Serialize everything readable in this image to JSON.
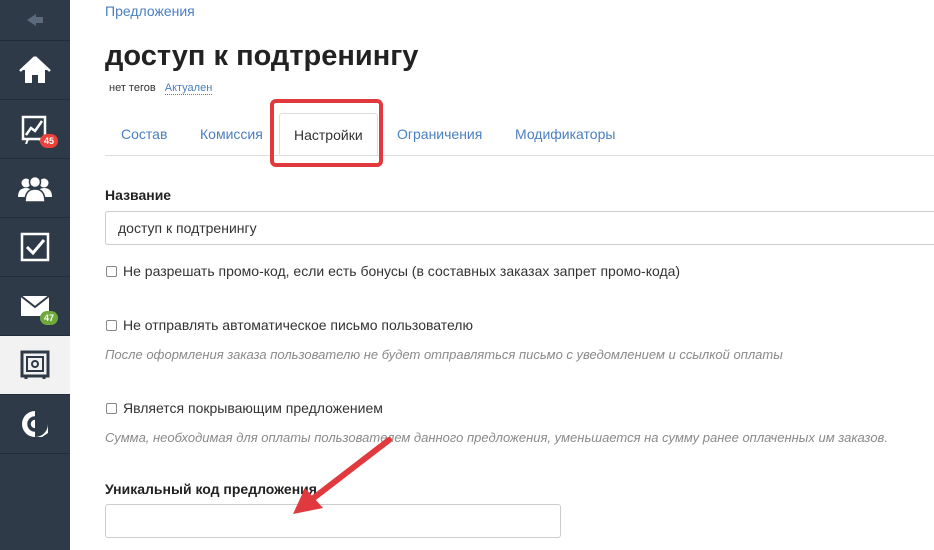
{
  "sidebar": {
    "collapse_icon": "collapse-arrow-icon",
    "items": [
      {
        "icon": "home-icon"
      },
      {
        "icon": "chart-icon",
        "badge": "45",
        "badge_color": "#e8423a"
      },
      {
        "icon": "users-icon"
      },
      {
        "icon": "checkbox-icon"
      },
      {
        "icon": "mail-icon",
        "badge": "47",
        "badge_color": "#6fa83b"
      },
      {
        "icon": "safe-icon",
        "active": true
      },
      {
        "icon": "brand-c-icon"
      }
    ]
  },
  "breadcrumb": "Предложения",
  "page_title": "доступ к подтренингу",
  "meta": {
    "tags": "нет тегов",
    "status": "Актуален"
  },
  "tabs": [
    {
      "label": "Состав"
    },
    {
      "label": "Комиссия"
    },
    {
      "label": "Настройки",
      "active": true
    },
    {
      "label": "Ограничения"
    },
    {
      "label": "Модификаторы"
    }
  ],
  "form": {
    "name_label": "Название",
    "name_value": "доступ к подтренингу",
    "option_promo": "Не разрешать промо-код, если есть бонусы (в составных заказах запрет промо-кода)",
    "option_no_email": "Не отправлять автоматическое письмо пользователю",
    "option_no_email_hint": "После оформления заказа пользователю не будет отправляться письмо с уведомлением и ссылкой оплаты",
    "option_covering": "Является покрывающим предложением",
    "option_covering_hint": "Сумма, необходимая для оплаты пользователем данного предложения, уменьшается на сумму ранее оплаченных им заказов.",
    "unique_code_label": "Уникальный код предложения",
    "unique_code_value": ""
  },
  "colors": {
    "sidebar_bg": "#2e3a48",
    "link": "#4a7fc0",
    "annotation": "#e0393e"
  }
}
